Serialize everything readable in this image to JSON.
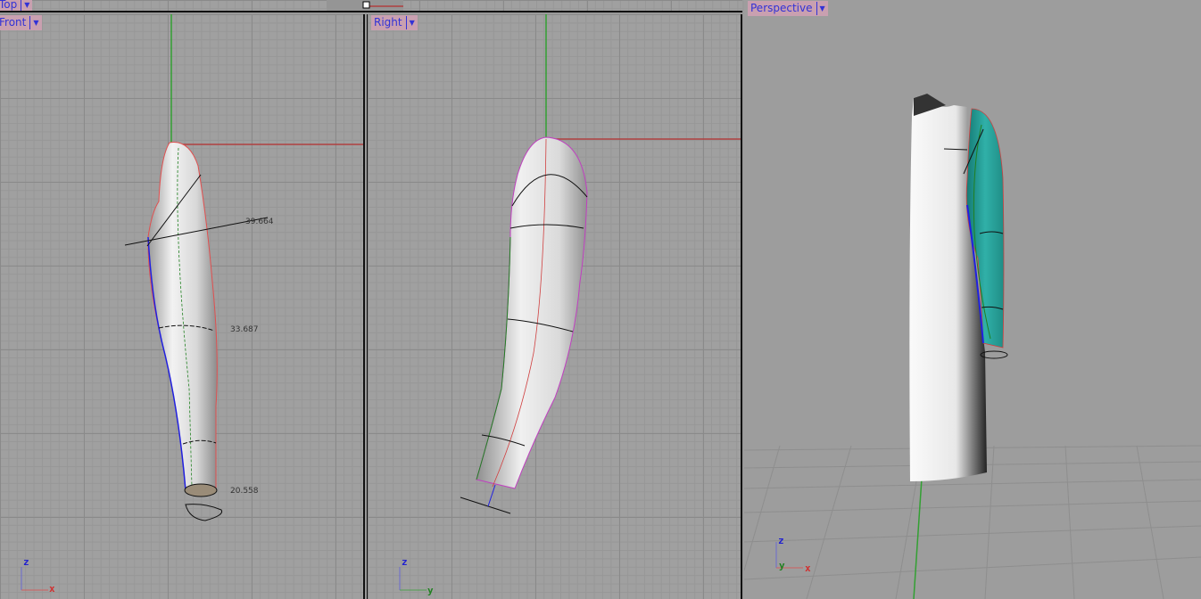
{
  "viewports": {
    "top": {
      "label": "Top"
    },
    "front": {
      "label": "Front",
      "dimensions": [
        "39.664",
        "33.687",
        "20.558"
      ],
      "axes": {
        "vertical": "z",
        "horizontal": "x"
      }
    },
    "right": {
      "label": "Right",
      "axes": {
        "vertical": "z",
        "horizontal": "y"
      }
    },
    "perspective": {
      "label": "Perspective",
      "axes": {
        "vertical": "z",
        "depth": "y",
        "horizontal": "x"
      }
    }
  },
  "dropdown_icon": "triangle-down-icon",
  "colors": {
    "tab_bg": "#c9a0b0",
    "tab_text": "#3232d6",
    "sleeve": "#2aa8a0",
    "x_axis": "#c04040",
    "y_axis": "#30a030",
    "z_axis": "#3030d0"
  }
}
